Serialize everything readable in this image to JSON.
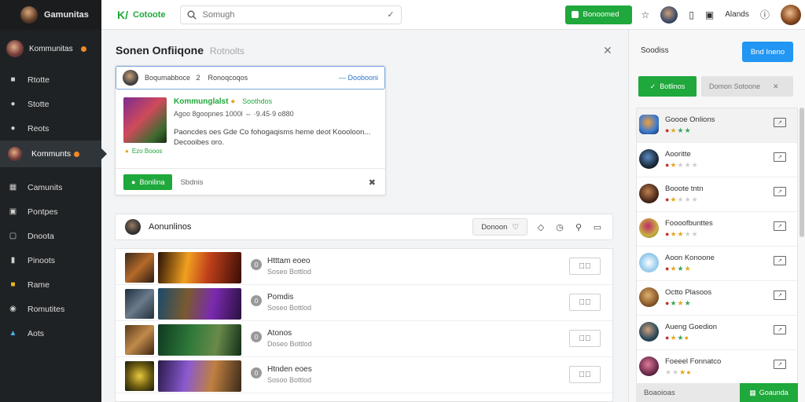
{
  "colors": {
    "accent_green": "#1fa83b",
    "accent_blue": "#2196f3",
    "sidebar_bg": "#1f2224"
  },
  "sidebar": {
    "brand": "Gamunitas",
    "user": {
      "name": "Kommunitas"
    },
    "items": [
      {
        "label": "Rtotte",
        "icon": "home-icon"
      },
      {
        "label": "Stotte",
        "icon": "chat-icon"
      },
      {
        "label": "Reots",
        "icon": "bell-icon"
      },
      {
        "label": "Kommunts",
        "icon": "user-icon"
      },
      {
        "label": "Camunits",
        "icon": "grid-icon"
      },
      {
        "label": "Pontpes",
        "icon": "folder-icon"
      },
      {
        "label": "Dnoota",
        "icon": "doc-icon"
      },
      {
        "label": "Pinoots",
        "icon": "phone-icon"
      },
      {
        "label": "Rame",
        "icon": "trophy-icon"
      },
      {
        "label": "Romutites",
        "icon": "globe-icon"
      },
      {
        "label": "Aots",
        "icon": "cloud-icon"
      }
    ]
  },
  "topbar": {
    "logo_mark": "K/",
    "logo_text": "Cotoote",
    "search_placeholder": "Somugh",
    "primary_button": "Bonoomed",
    "account_label": "Alands"
  },
  "main": {
    "title": "Sonen Onfiiqone",
    "title_sub": "Rotnolts",
    "card": {
      "head_text": "Boqumabboce   2    Ronoqcoqos",
      "head_link": "— Doobooni",
      "title": "Kommunglalst",
      "title_tag": "Soothdos",
      "meta": "Agoo 8goopnes 1000l ⇔ ·9.45·9 o880",
      "desc": "Paoncdes oes Gde Co fohogaqisms heme deot Koooloon... Decooibes oro.",
      "foot": "Ezo Booos",
      "action_primary": "Bonilina",
      "action_secondary": "Sbdnis"
    },
    "feed": {
      "title": "Aonunlinos",
      "filter_label": "Donoon",
      "rows": [
        {
          "num": "0",
          "title": "Htttam eoeo",
          "sub": "Soseo Bottlod",
          "action": "↗⃓"
        },
        {
          "num": "0",
          "title": "Pomdis",
          "sub": "Soseo Bottlod",
          "action": "↗⃓"
        },
        {
          "num": "0",
          "title": "Atonos",
          "sub": "Doseo Bottlod",
          "action": "↗⃓"
        },
        {
          "num": "0",
          "title": "Htnden eoes",
          "sub": "Sosoo Bottlod",
          "action": "↗⃓"
        }
      ]
    }
  },
  "right_panel": {
    "head": "Soodiss",
    "blue_button": "Bnd Ineno",
    "green_button": "Botlinos",
    "chip": "Domon Sotoone",
    "players": [
      {
        "name": "Goooe Onlions"
      },
      {
        "name": "Aooritte"
      },
      {
        "name": "Booote tntn"
      },
      {
        "name": "Foooofbunttes"
      },
      {
        "name": "Aoon Konoone"
      },
      {
        "name": "Octto Plasoos"
      },
      {
        "name": "Aueng Goedion"
      },
      {
        "name": "Foeeel Fonnatco"
      }
    ],
    "footer_label": "Boaoioas",
    "footer_button": "Goaunda"
  }
}
